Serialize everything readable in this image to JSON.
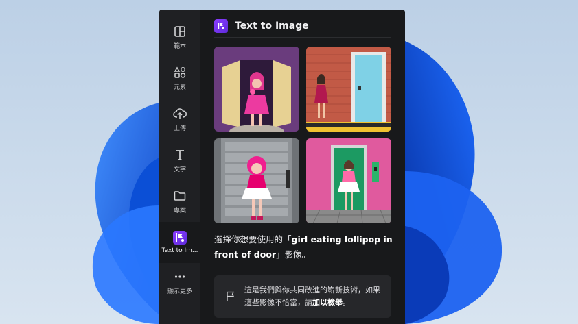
{
  "rail": {
    "items": [
      {
        "label": "範本",
        "icon": "template-icon"
      },
      {
        "label": "元素",
        "icon": "elements-icon"
      },
      {
        "label": "上傳",
        "icon": "upload-icon"
      },
      {
        "label": "文字",
        "icon": "text-icon"
      },
      {
        "label": "專案",
        "icon": "folder-icon"
      },
      {
        "label": "Text to Im...",
        "icon": "text-to-image-app-icon"
      },
      {
        "label": "顯示更多",
        "icon": "more-icon"
      }
    ]
  },
  "panel": {
    "title": "Text to Image",
    "caption": {
      "prefix": "選擇你想要使用的「",
      "prompt": "girl eating lollipop in front of door",
      "suffix": "」影像。"
    },
    "notice": {
      "text": "這是我們與你共同改進的嶄新技術，如果這些影像不恰當，請",
      "link": "加以檢舉",
      "end": "。"
    }
  },
  "colors": {
    "accent": "#8b3dff",
    "panel_bg": "#18191b",
    "rail_bg": "#1f2023"
  }
}
